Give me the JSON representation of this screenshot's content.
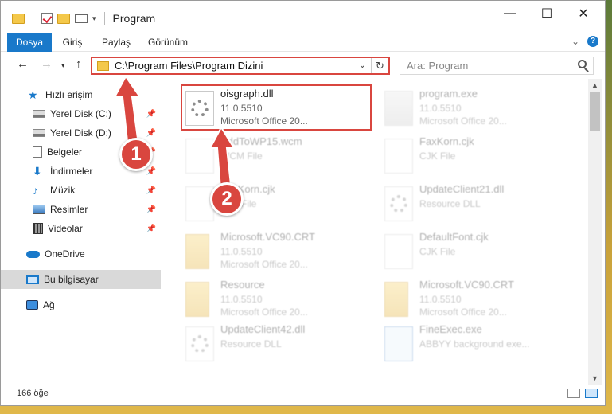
{
  "window": {
    "title": "Program",
    "minimize": "—",
    "maximize": "☐",
    "close": "✕"
  },
  "ribbon": {
    "tabs": [
      "Dosya",
      "Giriş",
      "Paylaş",
      "Görünüm"
    ],
    "help": "?"
  },
  "nav": {
    "address": "C:\\Program Files\\Program Dizini",
    "search_placeholder": "Ara: Program"
  },
  "sidebar": {
    "items": [
      {
        "label": "Hızlı erişim",
        "icon": "star-icon"
      },
      {
        "label": "Yerel Disk (C:)",
        "icon": "disk-icon",
        "pinned": true
      },
      {
        "label": "Yerel Disk (D:)",
        "icon": "disk-icon",
        "pinned": true
      },
      {
        "label": "Belgeler",
        "icon": "documents-icon",
        "pinned": true
      },
      {
        "label": "İndirmeler",
        "icon": "download-icon",
        "pinned": true
      },
      {
        "label": "Müzik",
        "icon": "music-icon",
        "pinned": true
      },
      {
        "label": "Resimler",
        "icon": "pictures-icon",
        "pinned": true
      },
      {
        "label": "Videolar",
        "icon": "videos-icon",
        "pinned": true
      },
      {
        "label": "OneDrive",
        "icon": "cloud-icon"
      },
      {
        "label": "Bu bilgisayar",
        "icon": "computer-icon",
        "selected": true
      },
      {
        "label": "Ağ",
        "icon": "network-icon"
      }
    ]
  },
  "files": [
    {
      "name": "oisgraph.dll",
      "line2": "11.0.5510",
      "line3": "Microsoft Office 20...",
      "icon": "dll-gear-icon"
    },
    {
      "name": "program.exe",
      "line2": "11.0.5510",
      "line3": "Microsoft Office 20...",
      "icon": "exe-icon"
    },
    {
      "name": "AddToWP15.wcm",
      "line2": "WCM File",
      "line3": "",
      "icon": "file-icon"
    },
    {
      "name": "FaxKorn.cjk",
      "line2": "CJK File",
      "line3": "",
      "icon": "file-icon"
    },
    {
      "name": "FaxKorn.cjk",
      "line2": "CJK File",
      "line3": "",
      "icon": "file-icon"
    },
    {
      "name": "UpdateClient21.dll",
      "line2": "Resource DLL",
      "line3": "",
      "icon": "dll-gear-icon"
    },
    {
      "name": "Microsoft.VC90.CRT",
      "line2": "11.0.5510",
      "line3": "Microsoft Office 20...",
      "icon": "folder-icon"
    },
    {
      "name": "DefaultFont.cjk",
      "line2": "CJK File",
      "line3": "",
      "icon": "file-icon"
    },
    {
      "name": "Resource",
      "line2": "11.0.5510",
      "line3": "Microsoft Office 20...",
      "icon": "folder-icon"
    },
    {
      "name": "Microsoft.VC90.CRT",
      "line2": "11.0.5510",
      "line3": "Microsoft Office 20...",
      "icon": "folder-icon"
    },
    {
      "name": "UpdateClient42.dll",
      "line2": "Resource DLL",
      "line3": "",
      "icon": "dll-gear-icon"
    },
    {
      "name": "FineExec.exe",
      "line2": "ABBYY background exe...",
      "line3": "",
      "icon": "window-exe-icon"
    }
  ],
  "status": {
    "count": "166 öğe"
  },
  "callouts": [
    "1",
    "2"
  ],
  "colors": {
    "accent": "#1979ca",
    "highlight": "#d9463f"
  }
}
